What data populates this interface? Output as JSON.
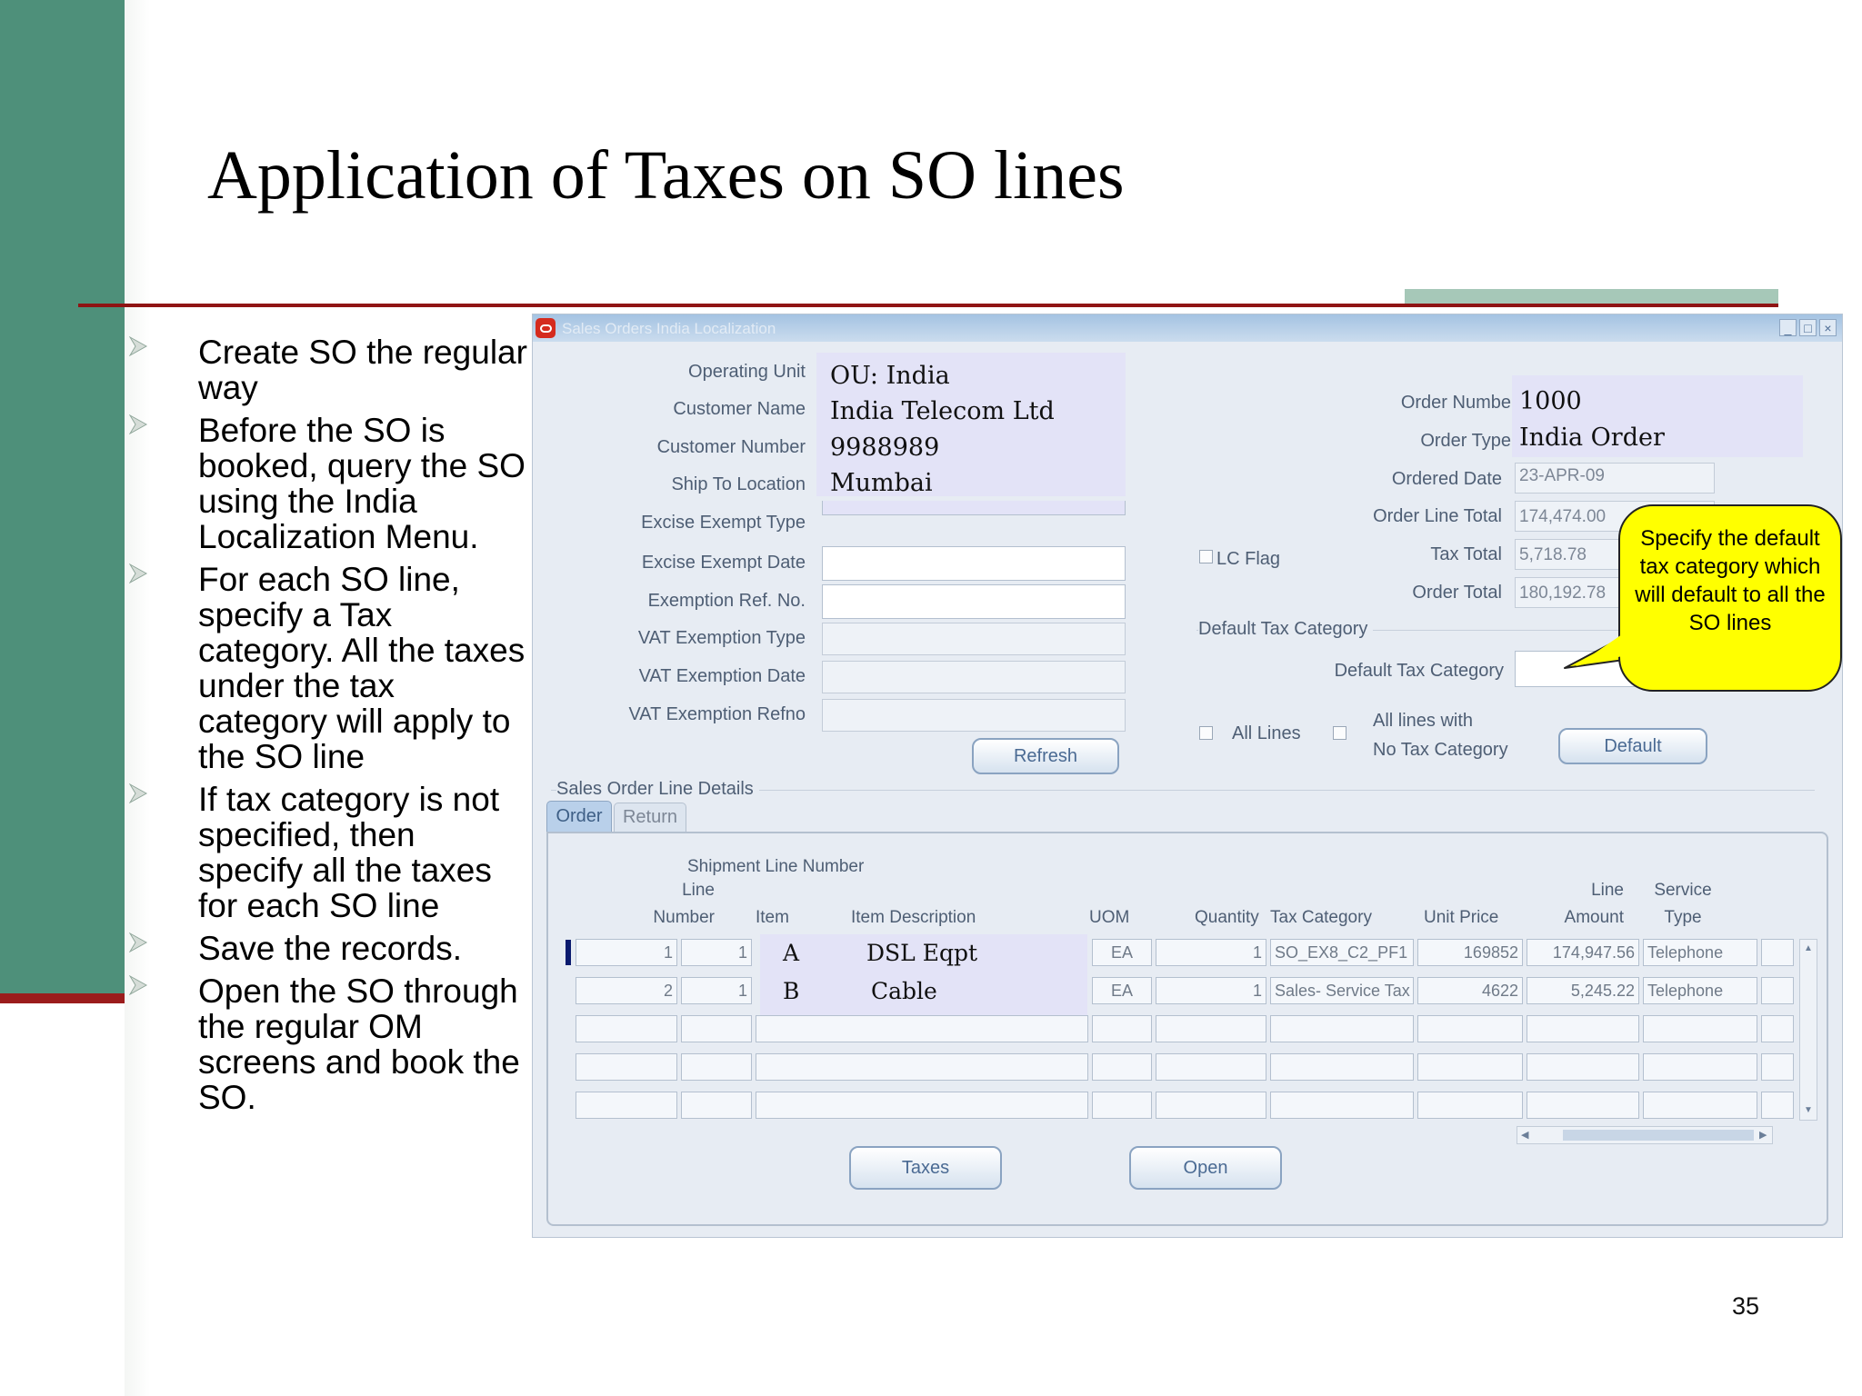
{
  "slide": {
    "title": "Application of Taxes on SO lines",
    "page_number": "35",
    "bullets": [
      "Create SO the regular way",
      "Before the SO is booked, query the SO using the India Localization Menu.",
      "For each SO line, specify a Tax category. All the taxes under the tax category will apply to the SO line",
      "If tax category is not specified, then specify all the taxes for each SO line",
      "Save the records.",
      "Open the SO through the regular OM screens and book the SO."
    ]
  },
  "window": {
    "title": "Sales Orders India Localization",
    "controls": [
      "_",
      "□",
      "×"
    ]
  },
  "header": {
    "labels": {
      "operating_unit": "Operating Unit",
      "customer_name": "Customer Name",
      "customer_number": "Customer Number",
      "ship_to_location": "Ship To Location",
      "excise_exempt_type": "Excise Exempt Type",
      "excise_exempt_date": "Excise Exempt Date",
      "exemption_ref_no": "Exemption Ref. No.",
      "vat_exemption_type": "VAT Exemption Type",
      "vat_exemption_date": "VAT Exemption Date",
      "vat_exemption_refno": "VAT Exemption Refno",
      "order_number": "Order Numbe",
      "order_type": "Order Type",
      "ordered_date": "Ordered Date",
      "order_line_total": "Order Line Total",
      "tax_total": "Tax Total",
      "order_total": "Order Total",
      "lc_flag": "LC Flag",
      "default_tax_category_group": "Default Tax Category",
      "default_tax_category": "Default Tax Category",
      "all_lines": "All Lines",
      "all_lines_no_tax_1": "All lines with",
      "all_lines_no_tax_2": "No Tax Category"
    },
    "values": {
      "operating_unit": "OU: India",
      "customer_name": "India Telecom Ltd",
      "customer_number": "9988989",
      "ship_to_location": "Mumbai",
      "order_number": "1000",
      "order_type": "India Order",
      "ordered_date": "23-APR-09",
      "order_line_total": "174,474.00",
      "tax_total": "5,718.78",
      "order_total": "180,192.78"
    },
    "buttons": {
      "refresh": "Refresh",
      "default": "Default"
    }
  },
  "callout": {
    "text": "Specify the default tax category which will default to all the SO lines"
  },
  "lines": {
    "section_title": "Sales Order Line Details",
    "tabs": [
      "Order",
      "Return"
    ],
    "headers": {
      "shipment_line_number": "Shipment Line Number",
      "line_number_1": "Line",
      "line_number_2": "Number",
      "item": "Item",
      "item_description": "Item Description",
      "uom": "UOM",
      "quantity": "Quantity",
      "tax_category": "Tax Category",
      "unit_price": "Unit Price",
      "line_amount_1": "Line",
      "line_amount_2": "Amount",
      "service_type_1": "Service",
      "service_type_2": "Type"
    },
    "rows": [
      {
        "line": "1",
        "shipment": "1",
        "item": "A",
        "description": "DSL Eqpt",
        "uom": "EA",
        "quantity": "1",
        "tax_category": "SO_EX8_C2_PF1",
        "unit_price": "169852",
        "amount": "174,947.56",
        "service_type": "Telephone"
      },
      {
        "line": "2",
        "shipment": "1",
        "item": "B",
        "description": "Cable",
        "uom": "EA",
        "quantity": "1",
        "tax_category": "Sales- Service Tax",
        "unit_price": "4622",
        "amount": "5,245.22",
        "service_type": "Telephone"
      }
    ],
    "buttons": {
      "taxes": "Taxes",
      "open": "Open"
    }
  },
  "colors": {
    "band_green": "#4e907a",
    "band_red": "#9b1c1c",
    "callout_yellow": "#ffff00",
    "form_background": "#e7ecf3"
  }
}
